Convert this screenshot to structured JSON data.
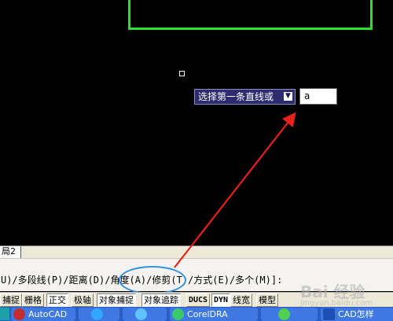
{
  "prompt": {
    "text": "选择第一条直线或",
    "dropdown_glyph": "▼"
  },
  "input": {
    "value": "a"
  },
  "layout_tab": {
    "label": "局2"
  },
  "command": {
    "line": "U)/多段线(P)/距离(D)/角度(A)/修剪(T)/方式(E)/多个(M)]:"
  },
  "status": {
    "buttons": [
      "捕捉",
      "栅格",
      "正交",
      "极轴",
      "对象捕捉",
      "对象追踪",
      "DUCS",
      "DYN",
      "线宽",
      "模型"
    ]
  },
  "taskbar": {
    "items": [
      {
        "label": "AutoCAD",
        "icon": "autocad-icon"
      },
      {
        "label": "",
        "icon": "browser-icon"
      },
      {
        "label": "",
        "icon": "chat-icon"
      },
      {
        "label": "CorelDRA",
        "icon": "coreldraw-icon"
      },
      {
        "label": "",
        "icon": "upload-icon"
      },
      {
        "label": "CAD怎样",
        "icon": "pz-icon"
      }
    ]
  },
  "watermark": {
    "main": "Bai 经验",
    "sub": "jingyan.baidu.com"
  },
  "colors": {
    "drawing_line": "#29e02a",
    "annotation_arrow": "#e8201a",
    "highlight_ellipse": "#2f8ee0",
    "prompt_bg": "#2e2b6e"
  }
}
